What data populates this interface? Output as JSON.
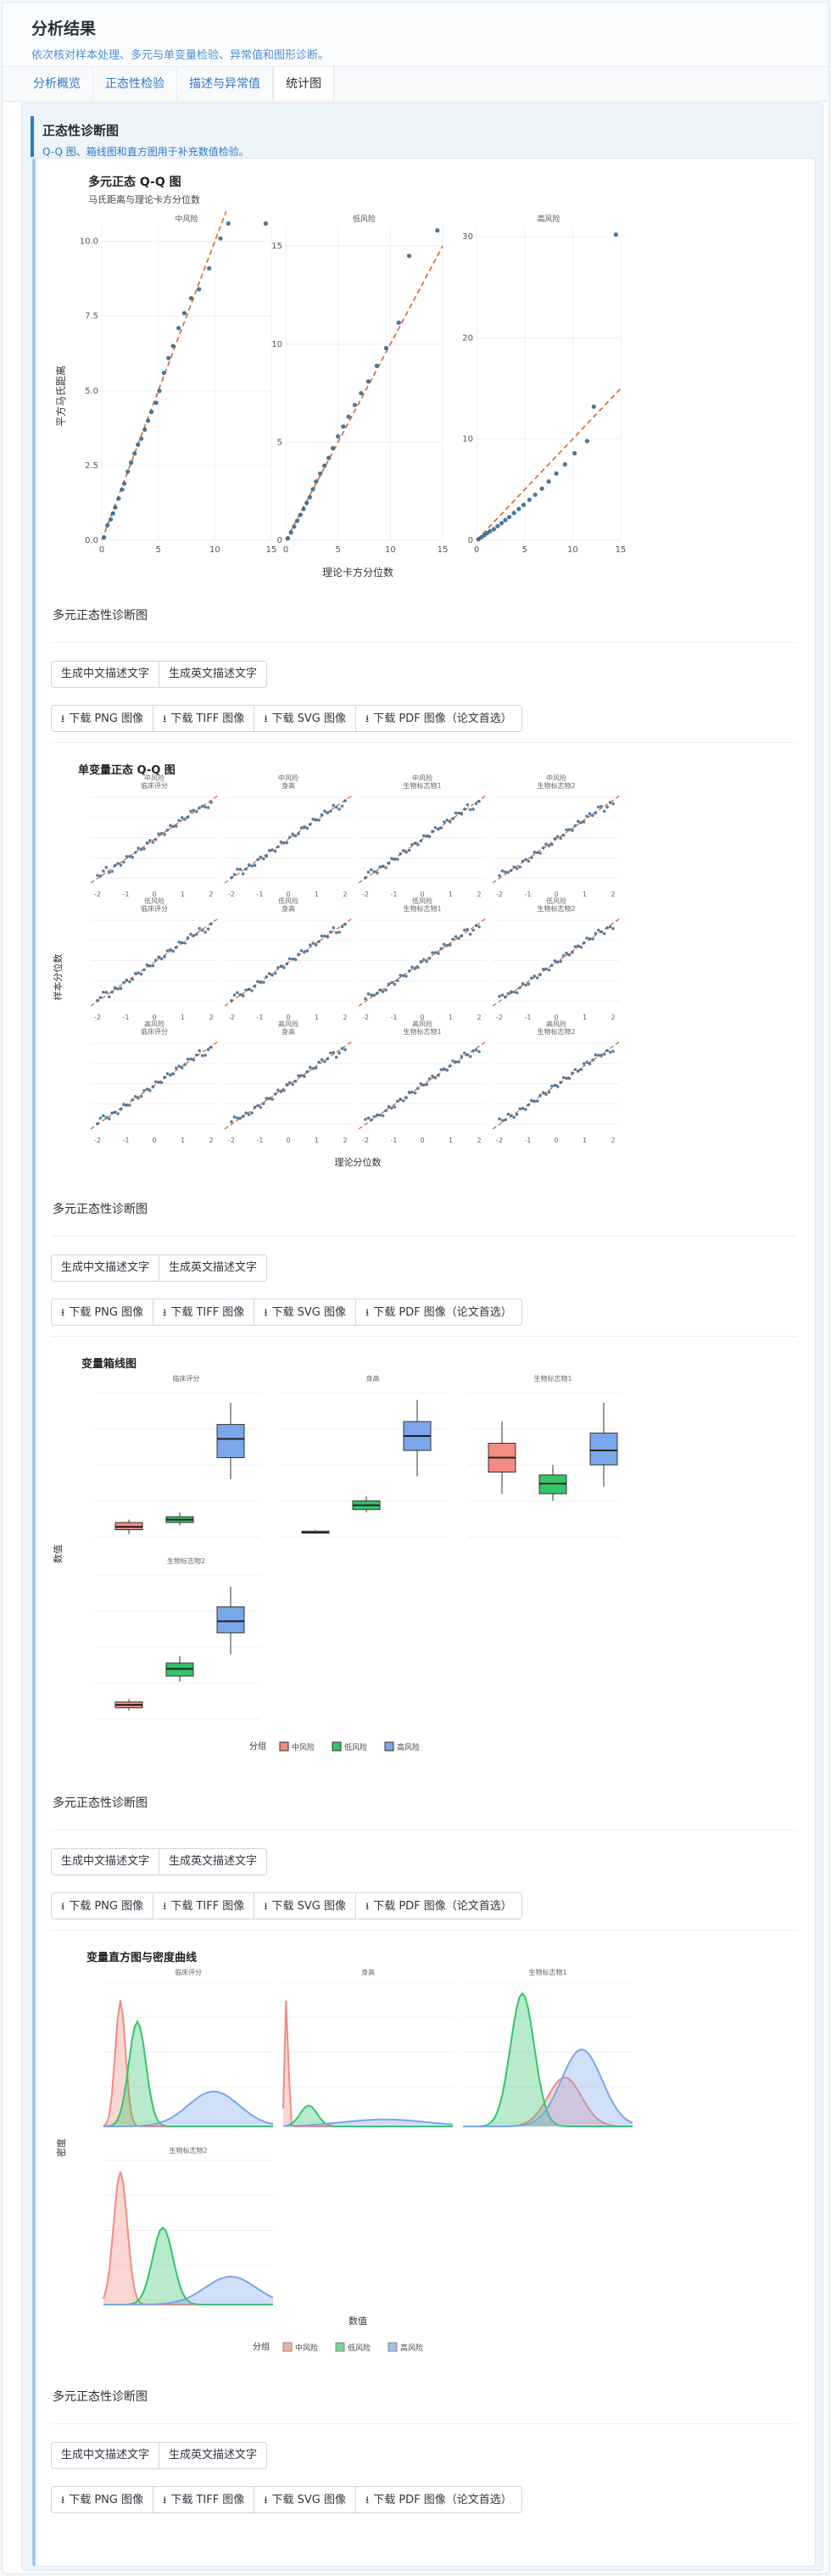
{
  "header": {
    "title": "分析结果",
    "subtitle": "依次核对样本处理、多元与单变量检验、异常值和图形诊断。"
  },
  "tabs": [
    {
      "label": "分析概览"
    },
    {
      "label": "正态性检验"
    },
    {
      "label": "描述与异常值"
    },
    {
      "label": "统计图"
    }
  ],
  "section": {
    "title": "正态性诊断图",
    "subtitle": "Q-Q 图、箱线图和直方图用于补充数值检验。"
  },
  "caption": "多元正态性诊断图",
  "desc_buttons": {
    "zh": "生成中文描述文字",
    "en": "生成英文描述文字"
  },
  "download_buttons": {
    "png": "下载 PNG 图像",
    "tiff": "下载 TIFF 图像",
    "svg": "下载 SVG 图像",
    "pdf": "下载 PDF 图像（论文首选）"
  },
  "icons": {
    "download": "download-icon"
  },
  "colors": {
    "accent": "#2f79c8",
    "low": "#f28b82",
    "mid": "#34c46a",
    "high": "#7aa6ea",
    "qq_point": "#2c5f8a",
    "qq_line": "#d9622b"
  },
  "groups": [
    "中风险",
    "低风险",
    "高风险"
  ],
  "variables": [
    "临床评分",
    "身高",
    "生物标志物1",
    "生物标志物2"
  ],
  "chart_data": [
    {
      "type": "scatter",
      "title": "多元正态 Q-Q 图",
      "subtitle": "马氏距离与理论卡方分位数",
      "xlabel": "理论卡方分位数",
      "ylabel": "平方马氏距离",
      "panels": [
        {
          "name": "中风险",
          "xlim": [
            0,
            15
          ],
          "ylim": [
            0,
            10.5
          ],
          "xticks": [
            0,
            5,
            10,
            15
          ],
          "yticks": [
            0,
            2.5,
            5,
            7.5,
            10
          ],
          "xticklabels": [
            "0",
            "5",
            "10",
            "15"
          ],
          "yticklabels": [
            "0.0",
            "2.5",
            "5.0",
            "7.5",
            "10.0"
          ],
          "points": [
            [
              0.2,
              0.1
            ],
            [
              0.5,
              0.5
            ],
            [
              0.8,
              0.7
            ],
            [
              1,
              0.9
            ],
            [
              1.2,
              1.1
            ],
            [
              1.5,
              1.4
            ],
            [
              1.8,
              1.7
            ],
            [
              2,
              1.9
            ],
            [
              2.3,
              2.3
            ],
            [
              2.6,
              2.6
            ],
            [
              2.9,
              2.9
            ],
            [
              3.2,
              3.2
            ],
            [
              3.5,
              3.4
            ],
            [
              3.8,
              3.7
            ],
            [
              4.1,
              4
            ],
            [
              4.4,
              4.3
            ],
            [
              4.8,
              4.6
            ],
            [
              5.1,
              5
            ],
            [
              5.5,
              5.6
            ],
            [
              5.9,
              6.1
            ],
            [
              6.3,
              6.5
            ],
            [
              6.8,
              7.1
            ],
            [
              7.3,
              7.6
            ],
            [
              7.9,
              8.1
            ],
            [
              8.6,
              8.4
            ],
            [
              9.5,
              9.1
            ],
            [
              10.5,
              10.1
            ],
            [
              11.2,
              10.6
            ],
            [
              14.5,
              10.6
            ]
          ],
          "line": [
            [
              0,
              0
            ],
            [
              11,
              11
            ]
          ]
        },
        {
          "name": "低风险",
          "xlim": [
            0,
            15
          ],
          "ylim": [
            0,
            16
          ],
          "xticks": [
            0,
            5,
            10,
            15
          ],
          "yticks": [
            0,
            5,
            10,
            15
          ],
          "xticklabels": [
            "0",
            "5",
            "10",
            "15"
          ],
          "yticklabels": [
            "0",
            "5",
            "10",
            "15"
          ],
          "points": [
            [
              0.2,
              0.1
            ],
            [
              0.5,
              0.4
            ],
            [
              0.8,
              0.7
            ],
            [
              1.1,
              1
            ],
            [
              1.4,
              1.3
            ],
            [
              1.7,
              1.6
            ],
            [
              2,
              1.9
            ],
            [
              2.3,
              2.2
            ],
            [
              2.6,
              2.6
            ],
            [
              2.9,
              3
            ],
            [
              3.3,
              3.4
            ],
            [
              3.7,
              3.8
            ],
            [
              4.1,
              4.2
            ],
            [
              4.5,
              4.7
            ],
            [
              5,
              5.3
            ],
            [
              5.5,
              5.8
            ],
            [
              6,
              6.3
            ],
            [
              6.6,
              6.9
            ],
            [
              7.2,
              7.5
            ],
            [
              7.9,
              8.1
            ],
            [
              8.7,
              8.9
            ],
            [
              9.6,
              9.8
            ],
            [
              10.8,
              11.1
            ],
            [
              11.8,
              14.5
            ],
            [
              14.5,
              15.8
            ]
          ],
          "line": [
            [
              0,
              0
            ],
            [
              15,
              15
            ]
          ]
        },
        {
          "name": "高风险",
          "xlim": [
            0,
            15
          ],
          "ylim": [
            0,
            31
          ],
          "xticks": [
            0,
            5,
            10,
            15
          ],
          "yticks": [
            0,
            10,
            20,
            30
          ],
          "xticklabels": [
            "0",
            "5",
            "10",
            "15"
          ],
          "yticklabels": [
            "0",
            "10",
            "20",
            "30"
          ],
          "points": [
            [
              0.2,
              0.1
            ],
            [
              0.5,
              0.3
            ],
            [
              0.8,
              0.5
            ],
            [
              1.1,
              0.7
            ],
            [
              1.4,
              0.9
            ],
            [
              1.8,
              1.1
            ],
            [
              2.2,
              1.4
            ],
            [
              2.6,
              1.7
            ],
            [
              3,
              2
            ],
            [
              3.4,
              2.3
            ],
            [
              3.9,
              2.7
            ],
            [
              4.4,
              3.1
            ],
            [
              4.9,
              3.5
            ],
            [
              5.5,
              4
            ],
            [
              6.1,
              4.5
            ],
            [
              6.8,
              5.1
            ],
            [
              7.5,
              5.8
            ],
            [
              8.3,
              6.6
            ],
            [
              9.2,
              7.5
            ],
            [
              10.2,
              8.6
            ],
            [
              11.5,
              9.8
            ],
            [
              12.2,
              13.2
            ],
            [
              14.5,
              30.2
            ]
          ],
          "line": [
            [
              0,
              0
            ],
            [
              15,
              15
            ]
          ]
        }
      ]
    },
    {
      "type": "scatter",
      "title": "单变量正态 Q-Q 图",
      "xlabel": "理论分位数",
      "ylabel": "样本分位数"
    },
    {
      "type": "bar",
      "title": "变量箱线图",
      "ylabel": "数值",
      "legend_title": "分组",
      "legend_position": "bottom"
    },
    {
      "type": "area",
      "title": "变量直方图与密度曲线",
      "xlabel": "数值",
      "ylabel": "密度",
      "legend_title": "分组",
      "legend_position": "bottom"
    }
  ]
}
